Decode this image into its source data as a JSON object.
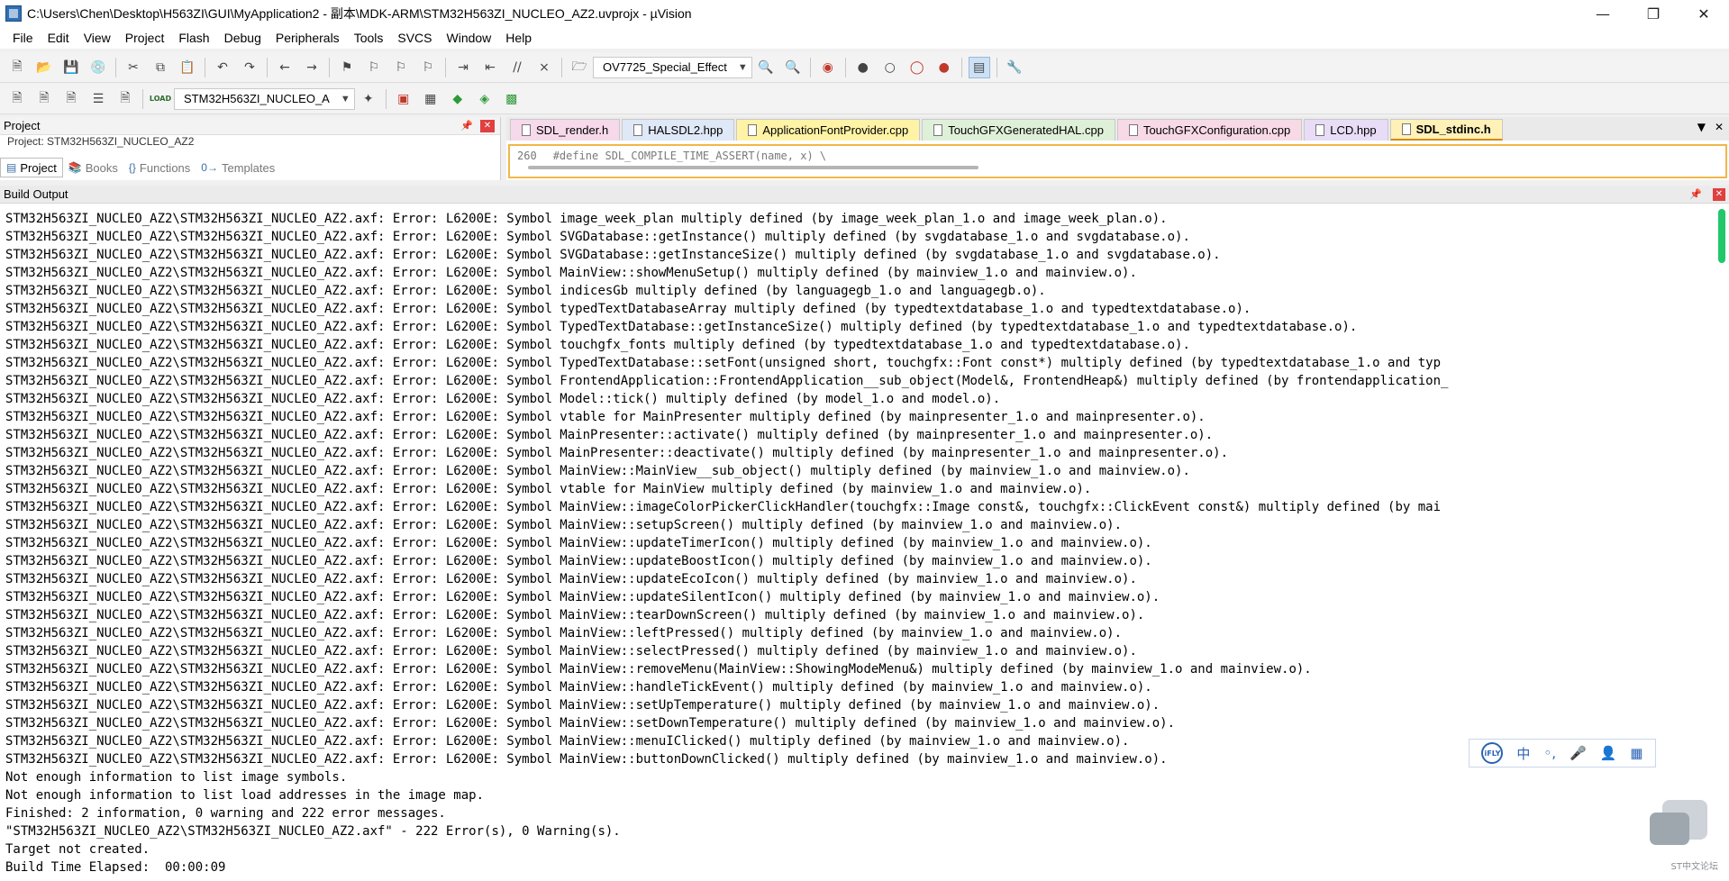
{
  "window": {
    "title": "C:\\Users\\Chen\\Desktop\\H563ZI\\GUI\\MyApplication2 - 副本\\MDK-ARM\\STM32H563ZI_NUCLEO_AZ2.uvprojx - µVision",
    "minimize_icon": "minimize-icon",
    "restore_icon": "restore-icon",
    "close_icon": "close-icon"
  },
  "menu": [
    "File",
    "Edit",
    "View",
    "Project",
    "Flash",
    "Debug",
    "Peripherals",
    "Tools",
    "SVCS",
    "Window",
    "Help"
  ],
  "toolbar1": {
    "combo_value": "OV7725_Special_Effect"
  },
  "toolbar2": {
    "target_value": "STM32H563ZI_NUCLEO_A",
    "load_label": "LOAD"
  },
  "project_panel": {
    "title": "Project",
    "tree_root": "Project: STM32H563ZI_NUCLEO_AZ2",
    "tabs": [
      "Project",
      "Books",
      "Functions",
      "Templates"
    ]
  },
  "editor": {
    "tabs": [
      "SDL_render.h",
      "HALSDL2.hpp",
      "ApplicationFontProvider.cpp",
      "TouchGFXGeneratedHAL.cpp",
      "TouchGFXConfiguration.cpp",
      "LCD.hpp",
      "SDL_stdinc.h"
    ],
    "active_tab": "SDL_stdinc.h",
    "code_line_number": "260",
    "code_line_text": "#define SDL_COMPILE_TIME_ASSERT(name, x)                    \\"
  },
  "build_output": {
    "title": "Build Output",
    "lines": [
      "STM32H563ZI_NUCLEO_AZ2\\STM32H563ZI_NUCLEO_AZ2.axf: Error: L6200E: Symbol image_week_plan multiply defined (by image_week_plan_1.o and image_week_plan.o).",
      "STM32H563ZI_NUCLEO_AZ2\\STM32H563ZI_NUCLEO_AZ2.axf: Error: L6200E: Symbol SVGDatabase::getInstance() multiply defined (by svgdatabase_1.o and svgdatabase.o).",
      "STM32H563ZI_NUCLEO_AZ2\\STM32H563ZI_NUCLEO_AZ2.axf: Error: L6200E: Symbol SVGDatabase::getInstanceSize() multiply defined (by svgdatabase_1.o and svgdatabase.o).",
      "STM32H563ZI_NUCLEO_AZ2\\STM32H563ZI_NUCLEO_AZ2.axf: Error: L6200E: Symbol MainView::showMenuSetup() multiply defined (by mainview_1.o and mainview.o).",
      "STM32H563ZI_NUCLEO_AZ2\\STM32H563ZI_NUCLEO_AZ2.axf: Error: L6200E: Symbol indicesGb multiply defined (by languagegb_1.o and languagegb.o).",
      "STM32H563ZI_NUCLEO_AZ2\\STM32H563ZI_NUCLEO_AZ2.axf: Error: L6200E: Symbol typedTextDatabaseArray multiply defined (by typedtextdatabase_1.o and typedtextdatabase.o).",
      "STM32H563ZI_NUCLEO_AZ2\\STM32H563ZI_NUCLEO_AZ2.axf: Error: L6200E: Symbol TypedTextDatabase::getInstanceSize() multiply defined (by typedtextdatabase_1.o and typedtextdatabase.o).",
      "STM32H563ZI_NUCLEO_AZ2\\STM32H563ZI_NUCLEO_AZ2.axf: Error: L6200E: Symbol touchgfx_fonts multiply defined (by typedtextdatabase_1.o and typedtextdatabase.o).",
      "STM32H563ZI_NUCLEO_AZ2\\STM32H563ZI_NUCLEO_AZ2.axf: Error: L6200E: Symbol TypedTextDatabase::setFont(unsigned short, touchgfx::Font const*) multiply defined (by typedtextdatabase_1.o and typ",
      "STM32H563ZI_NUCLEO_AZ2\\STM32H563ZI_NUCLEO_AZ2.axf: Error: L6200E: Symbol FrontendApplication::FrontendApplication__sub_object(Model&, FrontendHeap&) multiply defined (by frontendapplication_",
      "STM32H563ZI_NUCLEO_AZ2\\STM32H563ZI_NUCLEO_AZ2.axf: Error: L6200E: Symbol Model::tick() multiply defined (by model_1.o and model.o).",
      "STM32H563ZI_NUCLEO_AZ2\\STM32H563ZI_NUCLEO_AZ2.axf: Error: L6200E: Symbol vtable for MainPresenter multiply defined (by mainpresenter_1.o and mainpresenter.o).",
      "STM32H563ZI_NUCLEO_AZ2\\STM32H563ZI_NUCLEO_AZ2.axf: Error: L6200E: Symbol MainPresenter::activate() multiply defined (by mainpresenter_1.o and mainpresenter.o).",
      "STM32H563ZI_NUCLEO_AZ2\\STM32H563ZI_NUCLEO_AZ2.axf: Error: L6200E: Symbol MainPresenter::deactivate() multiply defined (by mainpresenter_1.o and mainpresenter.o).",
      "STM32H563ZI_NUCLEO_AZ2\\STM32H563ZI_NUCLEO_AZ2.axf: Error: L6200E: Symbol MainView::MainView__sub_object() multiply defined (by mainview_1.o and mainview.o).",
      "STM32H563ZI_NUCLEO_AZ2\\STM32H563ZI_NUCLEO_AZ2.axf: Error: L6200E: Symbol vtable for MainView multiply defined (by mainview_1.o and mainview.o).",
      "STM32H563ZI_NUCLEO_AZ2\\STM32H563ZI_NUCLEO_AZ2.axf: Error: L6200E: Symbol MainView::imageColorPickerClickHandler(touchgfx::Image const&, touchgfx::ClickEvent const&) multiply defined (by mai",
      "STM32H563ZI_NUCLEO_AZ2\\STM32H563ZI_NUCLEO_AZ2.axf: Error: L6200E: Symbol MainView::setupScreen() multiply defined (by mainview_1.o and mainview.o).",
      "STM32H563ZI_NUCLEO_AZ2\\STM32H563ZI_NUCLEO_AZ2.axf: Error: L6200E: Symbol MainView::updateTimerIcon() multiply defined (by mainview_1.o and mainview.o).",
      "STM32H563ZI_NUCLEO_AZ2\\STM32H563ZI_NUCLEO_AZ2.axf: Error: L6200E: Symbol MainView::updateBoostIcon() multiply defined (by mainview_1.o and mainview.o).",
      "STM32H563ZI_NUCLEO_AZ2\\STM32H563ZI_NUCLEO_AZ2.axf: Error: L6200E: Symbol MainView::updateEcoIcon() multiply defined (by mainview_1.o and mainview.o).",
      "STM32H563ZI_NUCLEO_AZ2\\STM32H563ZI_NUCLEO_AZ2.axf: Error: L6200E: Symbol MainView::updateSilentIcon() multiply defined (by mainview_1.o and mainview.o).",
      "STM32H563ZI_NUCLEO_AZ2\\STM32H563ZI_NUCLEO_AZ2.axf: Error: L6200E: Symbol MainView::tearDownScreen() multiply defined (by mainview_1.o and mainview.o).",
      "STM32H563ZI_NUCLEO_AZ2\\STM32H563ZI_NUCLEO_AZ2.axf: Error: L6200E: Symbol MainView::leftPressed() multiply defined (by mainview_1.o and mainview.o).",
      "STM32H563ZI_NUCLEO_AZ2\\STM32H563ZI_NUCLEO_AZ2.axf: Error: L6200E: Symbol MainView::selectPressed() multiply defined (by mainview_1.o and mainview.o).",
      "STM32H563ZI_NUCLEO_AZ2\\STM32H563ZI_NUCLEO_AZ2.axf: Error: L6200E: Symbol MainView::removeMenu(MainView::ShowingModeMenu&) multiply defined (by mainview_1.o and mainview.o).",
      "STM32H563ZI_NUCLEO_AZ2\\STM32H563ZI_NUCLEO_AZ2.axf: Error: L6200E: Symbol MainView::handleTickEvent() multiply defined (by mainview_1.o and mainview.o).",
      "STM32H563ZI_NUCLEO_AZ2\\STM32H563ZI_NUCLEO_AZ2.axf: Error: L6200E: Symbol MainView::setUpTemperature() multiply defined (by mainview_1.o and mainview.o).",
      "STM32H563ZI_NUCLEO_AZ2\\STM32H563ZI_NUCLEO_AZ2.axf: Error: L6200E: Symbol MainView::setDownTemperature() multiply defined (by mainview_1.o and mainview.o).",
      "STM32H563ZI_NUCLEO_AZ2\\STM32H563ZI_NUCLEO_AZ2.axf: Error: L6200E: Symbol MainView::menuIClicked() multiply defined (by mainview_1.o and mainview.o).",
      "STM32H563ZI_NUCLEO_AZ2\\STM32H563ZI_NUCLEO_AZ2.axf: Error: L6200E: Symbol MainView::buttonDownClicked() multiply defined (by mainview_1.o and mainview.o).",
      "Not enough information to list image symbols.",
      "Not enough information to list load addresses in the image map.",
      "Finished: 2 information, 0 warning and 222 error messages.",
      "\"STM32H563ZI_NUCLEO_AZ2\\STM32H563ZI_NUCLEO_AZ2.axf\" - 222 Error(s), 0 Warning(s).",
      "Target not created.",
      "Build Time Elapsed:  00:00:09"
    ]
  },
  "ime_toolbar": {
    "ifly_label": "iFLY",
    "zh_label": "中"
  },
  "watermark": {
    "text": "ST中文论坛"
  }
}
